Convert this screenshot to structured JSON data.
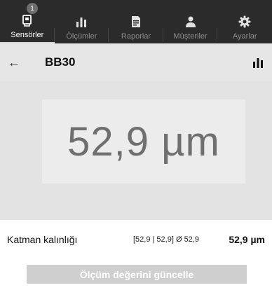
{
  "tabs": [
    {
      "label": "Sensörler",
      "icon": "sensor-icon",
      "active": true,
      "badge": "1"
    },
    {
      "label": "Ölçümler",
      "icon": "bar-chart-icon",
      "active": false
    },
    {
      "label": "Raporlar",
      "icon": "report-icon",
      "active": false
    },
    {
      "label": "Müşteriler",
      "icon": "customers-icon",
      "active": false
    },
    {
      "label": "Ayarlar",
      "icon": "gear-icon",
      "active": false
    }
  ],
  "header": {
    "back": "←",
    "title": "BB30"
  },
  "reading": {
    "value": "52,9 µm"
  },
  "measurement": {
    "label": "Katman kalınlığı",
    "stats": "[52,9 | 52,9] Ø 52,9",
    "value": "52,9 µm"
  },
  "actions": {
    "update_label": "Ölçüm değerini güncelle"
  },
  "colors": {
    "tabbar_bg": "#2b2b2b",
    "header_bg": "#e6e6e6",
    "stage_bg": "#e3e3e3",
    "button_bg": "#cfcfcf"
  }
}
